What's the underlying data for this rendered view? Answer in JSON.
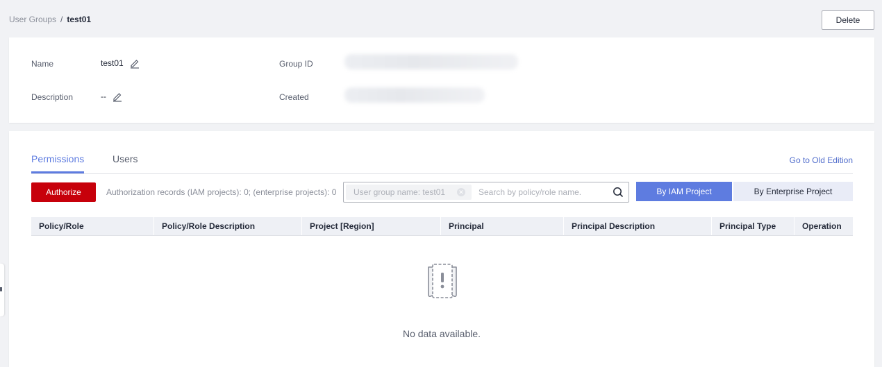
{
  "breadcrumb": {
    "parent": "User Groups",
    "separator": "/",
    "current": "test01"
  },
  "actions": {
    "delete_label": "Delete"
  },
  "details": {
    "name_label": "Name",
    "name_value": "test01",
    "description_label": "Description",
    "description_value": "--",
    "group_id_label": "Group ID",
    "created_label": "Created"
  },
  "tabs": [
    {
      "label": "Permissions",
      "active": true
    },
    {
      "label": "Users",
      "active": false
    }
  ],
  "old_edition_link": "Go to Old Edition",
  "toolbar": {
    "authorize_label": "Authorize",
    "records_text": "Authorization records (IAM projects): 0; (enterprise projects): 0",
    "filter_chip": "User group name: test01",
    "search_placeholder": "Search by policy/role name.",
    "view_buttons": [
      {
        "label": "By IAM Project",
        "active": true
      },
      {
        "label": "By Enterprise Project",
        "active": false
      }
    ]
  },
  "table": {
    "columns": [
      "Policy/Role",
      "Policy/Role Description",
      "Project [Region]",
      "Principal",
      "Principal Description",
      "Principal Type",
      "Operation"
    ],
    "empty_text": "No data available."
  },
  "icons": {
    "edit": "pencil-icon",
    "search": "magnifier-icon",
    "empty": "empty-box-exclamation-icon",
    "chip_close": "close-circle-icon"
  },
  "colors": {
    "accent": "#5e7ce0",
    "danger": "#c7000b",
    "link": "#526ecc"
  }
}
